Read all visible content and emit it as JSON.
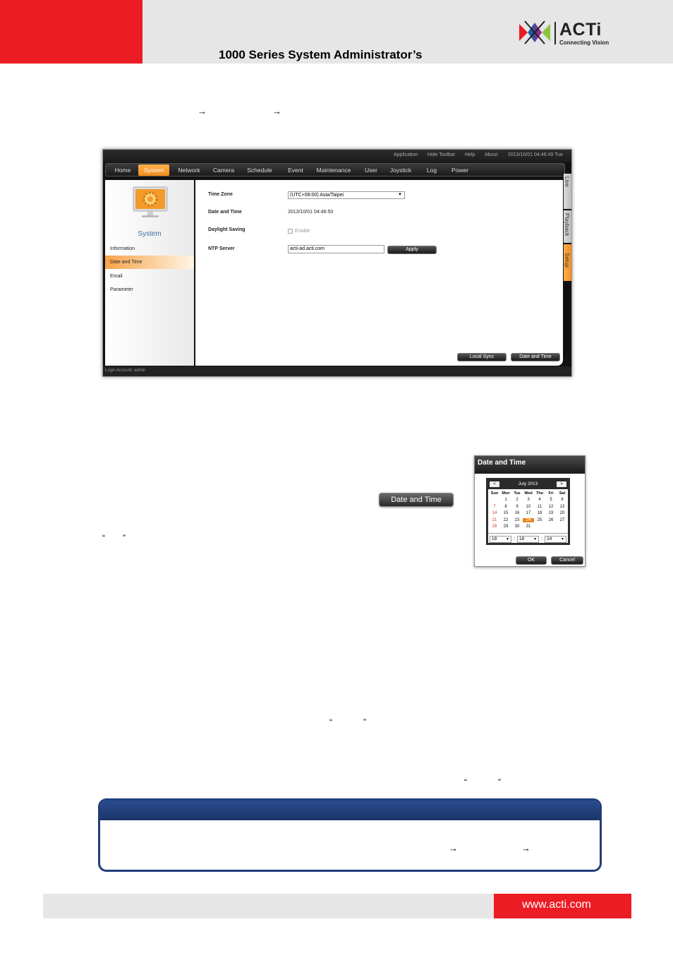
{
  "header": {
    "title": "1000 Series System Administrator’s",
    "logo_text": "ACTi",
    "logo_subtext": "Connecting Vision"
  },
  "body_glyphs": {
    "arrow": "→",
    "open_quote": "“",
    "close_quote": "”"
  },
  "screenshot": {
    "top_links": [
      "Application",
      "Hide Toolbar",
      "Help",
      "About",
      "2013/10/01 04:46:49 Tue"
    ],
    "nav_items": [
      "Home",
      "System",
      "Network",
      "Camera",
      "Schedule",
      "Event",
      "Maintenance",
      "User",
      "Joystick",
      "Log",
      "Power"
    ],
    "active_nav": "System",
    "sidebar": {
      "title": "System",
      "items": [
        "Information",
        "Date and Time",
        "Email",
        "Parameter"
      ]
    },
    "form": {
      "time_zone_label": "Time Zone",
      "time_zone_value": "(UTC+08:00) Asia/Taipei",
      "date_time_label": "Date and Time",
      "date_time_value": "2013/10/01 04:46:50",
      "daylight_label": "Daylight Saving",
      "daylight_option": "Enable",
      "ntp_label": "NTP Server",
      "ntp_value": "acti-ad.acti.com",
      "apply_label": "Apply",
      "local_sync_label": "Local Sync",
      "date_time_button": "Date and Time"
    },
    "right_tabs": [
      "Live",
      "Playback",
      "Setup"
    ],
    "status_text": "Login Account: admin"
  },
  "standalone_button": "Date and Time",
  "dialog": {
    "title": "Date and Time",
    "month": "July 2013",
    "prev": "<",
    "next": ">",
    "weekdays": [
      "Sun",
      "Mon",
      "Tue",
      "Wed",
      "Thu",
      "Fri",
      "Sat"
    ],
    "weeks": [
      [
        "",
        "1",
        "2",
        "3",
        "4",
        "5",
        "6"
      ],
      [
        "7",
        "8",
        "9",
        "10",
        "11",
        "12",
        "13"
      ],
      [
        "14",
        "15",
        "16",
        "17",
        "18",
        "19",
        "20"
      ],
      [
        "21",
        "22",
        "23",
        "24",
        "25",
        "26",
        "27"
      ],
      [
        "28",
        "29",
        "30",
        "31",
        "",
        "",
        ""
      ]
    ],
    "selected_day": "24",
    "hour": "18",
    "minute": "18",
    "second": "24",
    "time_separator": ":",
    "ok_label": "OK",
    "cancel_label": "Cancel"
  },
  "footer": {
    "url": "www.acti.com"
  },
  "colors": {
    "brand_red": "#ec1c24",
    "accent_orange": "#f28c1e",
    "note_blue": "#1f3d7a"
  }
}
